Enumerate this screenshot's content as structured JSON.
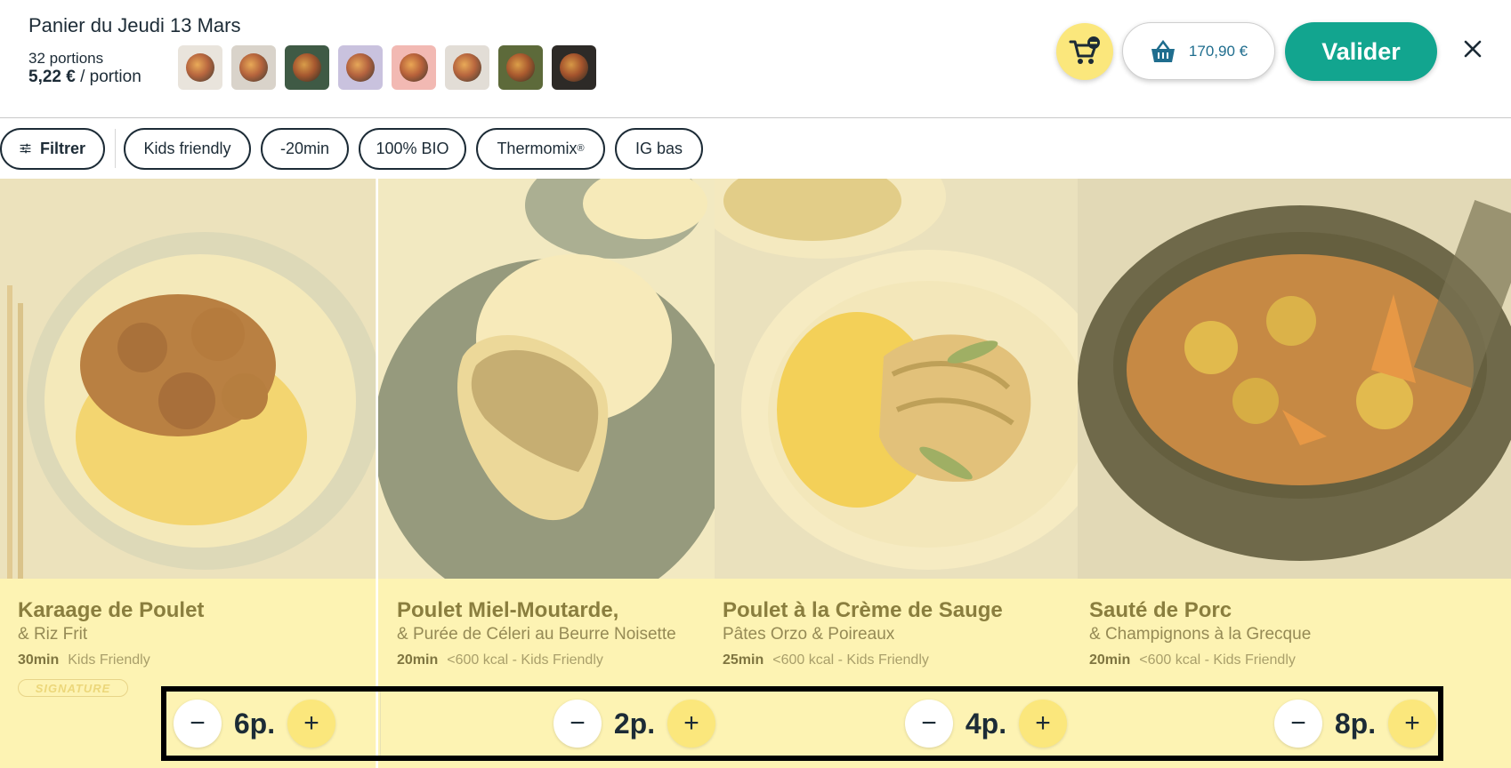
{
  "header": {
    "title": "Panier du Jeudi 13 Mars",
    "portions": "32 portions",
    "price_per_portion": "5,22 €",
    "price_per_portion_suffix": " / portion",
    "total": "170,90 €",
    "validate_label": "Valider",
    "close_icon": "close-icon",
    "cart_remove_icon": "cart-remove-icon",
    "basket_icon": "basket-icon"
  },
  "filters": {
    "filter_label": "Filtrer",
    "chips": [
      "Kids friendly",
      "-20min",
      "100% BIO",
      "Thermomix",
      "IG bas"
    ],
    "thermomix_mark": "®"
  },
  "recipes": [
    {
      "title": "Karaage de Poulet",
      "subtitle": "& Riz Frit",
      "time": "30min",
      "tags": "Kids Friendly",
      "badges": [
        "SIGNATURE"
      ],
      "quantity": "6p."
    },
    {
      "title": "Poulet Miel-Moutarde,",
      "subtitle": "& Purée de Céleri au Beurre Noisette",
      "time": "20min",
      "tags": "<600 kcal - Kids Friendly",
      "badges": [],
      "quantity": "2p."
    },
    {
      "title": "Poulet à la Crème de Sauge",
      "subtitle": "Pâtes Orzo & Poireaux",
      "time": "25min",
      "tags": "<600 kcal - Kids Friendly",
      "badges": [],
      "quantity": "4p."
    },
    {
      "title": "Sauté de Porc",
      "subtitle": "& Champignons à la Grecque",
      "time": "20min",
      "tags": "<600 kcal - Kids Friendly",
      "badges": [],
      "quantity": "8p."
    }
  ],
  "stepper": {
    "minus": "−",
    "plus": "+"
  },
  "colors": {
    "accent": "#12a58f",
    "yellow": "#fbe77c",
    "card_bg": "#fdf3b3",
    "text": "#1c2b36"
  }
}
